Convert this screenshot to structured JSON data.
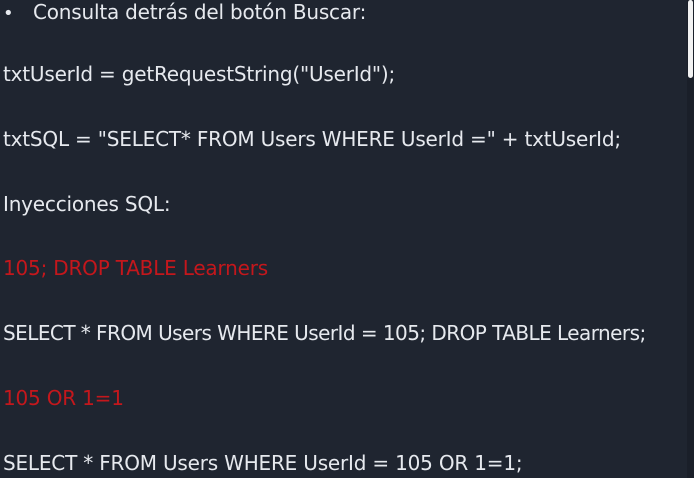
{
  "content": {
    "bullet_glyph": "•",
    "heading": "Consulta detrás del botón Buscar:",
    "line_userid": "txtUserId = getRequestString(\"UserId\");",
    "line_sql": "txtSQL = \"SELECT* FROM Users WHERE UserId =\" + txtUserId;",
    "injections_label": "Inyecciones SQL:",
    "payload_1": "105; DROP TABLE Learners",
    "query_1": "SELECT * FROM Users WHERE UserId = 105; DROP TABLE Learners;",
    "payload_2": "105 OR 1=1",
    "query_2": "SELECT * FROM Users WHERE UserId = 105 OR 1=1;"
  },
  "colors": {
    "background": "#1f2530",
    "text": "#e6e9ee",
    "highlight": "#c4171c"
  }
}
